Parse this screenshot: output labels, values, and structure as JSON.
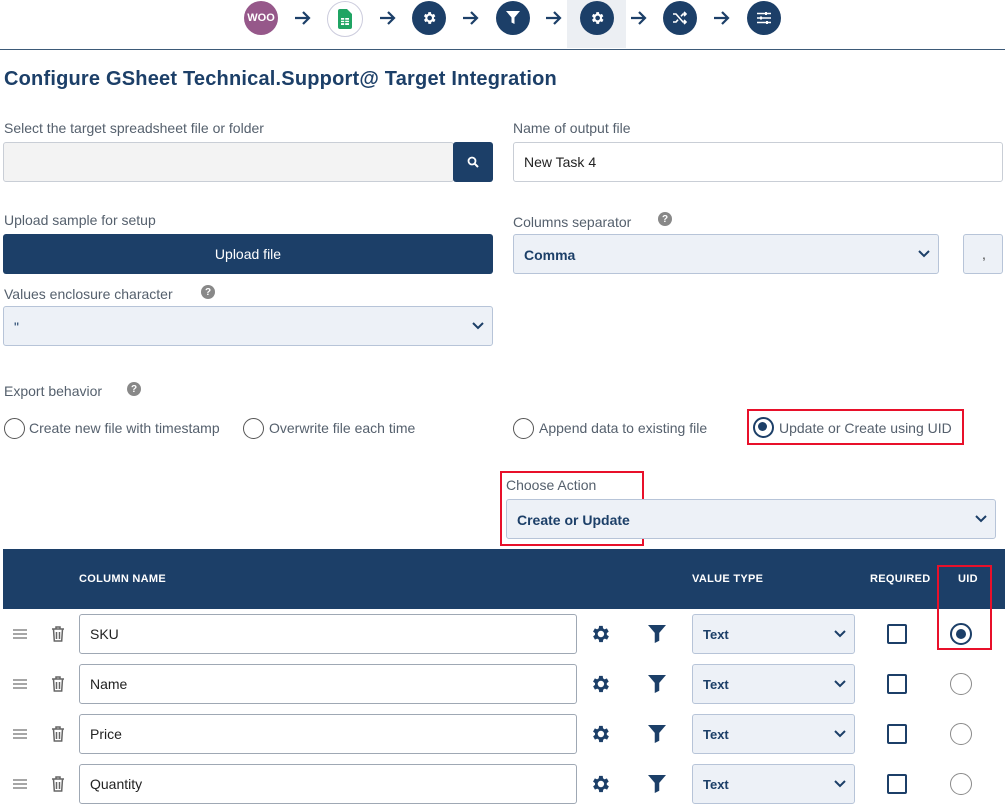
{
  "steps": [
    {
      "icon": "woocommerce-icon",
      "label": "WOO"
    },
    {
      "icon": "google-sheets-icon"
    },
    {
      "icon": "gear-icon"
    },
    {
      "icon": "filter-icon"
    },
    {
      "icon": "gear-icon",
      "active": true
    },
    {
      "icon": "shuffle-icon"
    },
    {
      "icon": "sliders-icon"
    }
  ],
  "page": {
    "title": "Configure GSheet Technical.Support@ Target Integration"
  },
  "target_file": {
    "label": "Select the target spreadsheet file or folder",
    "value": ""
  },
  "output_file": {
    "label": "Name of output file",
    "value": "New Task 4"
  },
  "upload": {
    "label": "Upload sample for setup",
    "button": "Upload file"
  },
  "separator": {
    "label": "Columns separator",
    "value": "Comma",
    "char": ","
  },
  "enclosure": {
    "label": "Values enclosure character",
    "value": "\""
  },
  "export": {
    "label": "Export behavior",
    "options": [
      {
        "label": "Create new file with timestamp",
        "selected": false
      },
      {
        "label": "Overwrite file each time",
        "selected": false
      },
      {
        "label": "Append data to existing file",
        "selected": false
      },
      {
        "label": "Update or Create using UID",
        "selected": true
      }
    ]
  },
  "action": {
    "label": "Choose Action",
    "value": "Create or Update"
  },
  "table": {
    "headers": {
      "column_name": "COLUMN NAME",
      "value_type": "VALUE TYPE",
      "required": "REQUIRED",
      "uid": "UID"
    },
    "rows": [
      {
        "name": "SKU",
        "type": "Text",
        "required": false,
        "uid": true
      },
      {
        "name": "Name",
        "type": "Text",
        "required": false,
        "uid": false
      },
      {
        "name": "Price",
        "type": "Text",
        "required": false,
        "uid": false
      },
      {
        "name": "Quantity",
        "type": "Text",
        "required": false,
        "uid": false
      }
    ]
  },
  "colors": {
    "primary": "#1c3f68",
    "highlight": "#e8102a",
    "woo": "#96588a",
    "sheets": "#1fa463"
  }
}
